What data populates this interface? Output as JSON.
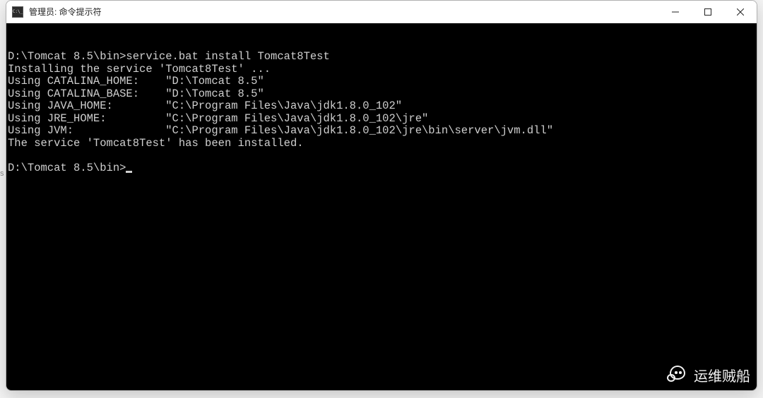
{
  "window": {
    "title": "管理员: 命令提示符"
  },
  "terminal": {
    "lines": [
      "",
      "D:\\Tomcat 8.5\\bin>service.bat install Tomcat8Test",
      "Installing the service 'Tomcat8Test' ...",
      "Using CATALINA_HOME:    \"D:\\Tomcat 8.5\"",
      "Using CATALINA_BASE:    \"D:\\Tomcat 8.5\"",
      "Using JAVA_HOME:        \"C:\\Program Files\\Java\\jdk1.8.0_102\"",
      "Using JRE_HOME:         \"C:\\Program Files\\Java\\jdk1.8.0_102\\jre\"",
      "Using JVM:              \"C:\\Program Files\\Java\\jdk1.8.0_102\\jre\\bin\\server\\jvm.dll\"",
      "The service 'Tomcat8Test' has been installed.",
      ""
    ],
    "prompt": "D:\\Tomcat 8.5\\bin>"
  },
  "watermark": {
    "text": "运维贼船"
  },
  "edge_text": "s"
}
